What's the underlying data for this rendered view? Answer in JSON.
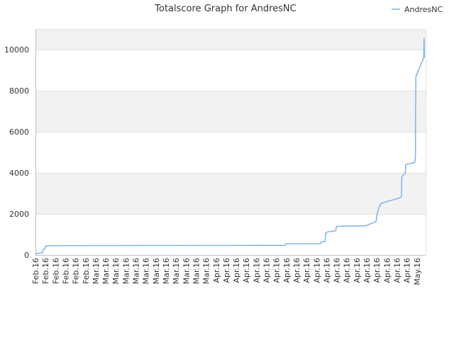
{
  "chart_data": {
    "type": "line",
    "title": "Totalscore Graph for AndresNC",
    "legend": {
      "position": "top-right",
      "entries": [
        "AndresNC"
      ]
    },
    "ylim": [
      0,
      11000
    ],
    "y_ticks": [
      0,
      2000,
      4000,
      6000,
      8000,
      10000
    ],
    "y_tick_labels": [
      "0",
      "2000",
      "4000",
      "6000",
      "8000",
      "10000"
    ],
    "x_tick_labels": [
      "Feb.16",
      "Feb.16",
      "Feb.16",
      "Feb.16",
      "Feb.16",
      "Feb.16",
      "Mar.16",
      "Mar.16",
      "Mar.16",
      "Mar.16",
      "Mar.16",
      "Mar.16",
      "Mar.16",
      "Mar.16",
      "Mar.16",
      "Mar.16",
      "Mar.16",
      "Mar.16",
      "Apr.16",
      "Apr.16",
      "Apr.16",
      "Apr.16",
      "Apr.16",
      "Apr.16",
      "Apr.16",
      "Apr.16",
      "Apr.16",
      "Apr.16",
      "Apr.16",
      "Apr.16",
      "Apr.16",
      "Apr.16",
      "Apr.16",
      "Apr.16",
      "Apr.16",
      "Apr.16",
      "Apr.16",
      "Apr.16",
      "May.16"
    ],
    "grid": true,
    "band_fill": "#f2f2f2",
    "series": [
      {
        "name": "AndresNC",
        "color": "#7cb5ec",
        "points": [
          [
            0.0,
            0
          ],
          [
            0.002,
            80
          ],
          [
            0.018,
            100
          ],
          [
            0.02,
            280
          ],
          [
            0.024,
            300
          ],
          [
            0.026,
            430
          ],
          [
            0.03,
            450
          ],
          [
            0.1,
            460
          ],
          [
            0.64,
            470
          ],
          [
            0.642,
            540
          ],
          [
            0.73,
            550
          ],
          [
            0.732,
            640
          ],
          [
            0.742,
            650
          ],
          [
            0.744,
            1050
          ],
          [
            0.748,
            1120
          ],
          [
            0.76,
            1150
          ],
          [
            0.77,
            1180
          ],
          [
            0.771,
            1380
          ],
          [
            0.775,
            1400
          ],
          [
            0.846,
            1420
          ],
          [
            0.87,
            1600
          ],
          [
            0.873,
            1620
          ],
          [
            0.875,
            1950
          ],
          [
            0.88,
            2300
          ],
          [
            0.885,
            2500
          ],
          [
            0.9,
            2600
          ],
          [
            0.92,
            2700
          ],
          [
            0.935,
            2800
          ],
          [
            0.938,
            2850
          ],
          [
            0.939,
            3800
          ],
          [
            0.943,
            3900
          ],
          [
            0.948,
            4000
          ],
          [
            0.949,
            4400
          ],
          [
            0.96,
            4450
          ],
          [
            0.972,
            4500
          ],
          [
            0.974,
            4800
          ],
          [
            0.974,
            6500
          ],
          [
            0.975,
            8700
          ],
          [
            0.995,
            9600
          ],
          [
            0.996,
            10550
          ],
          [
            0.997,
            9600
          ]
        ]
      }
    ]
  }
}
